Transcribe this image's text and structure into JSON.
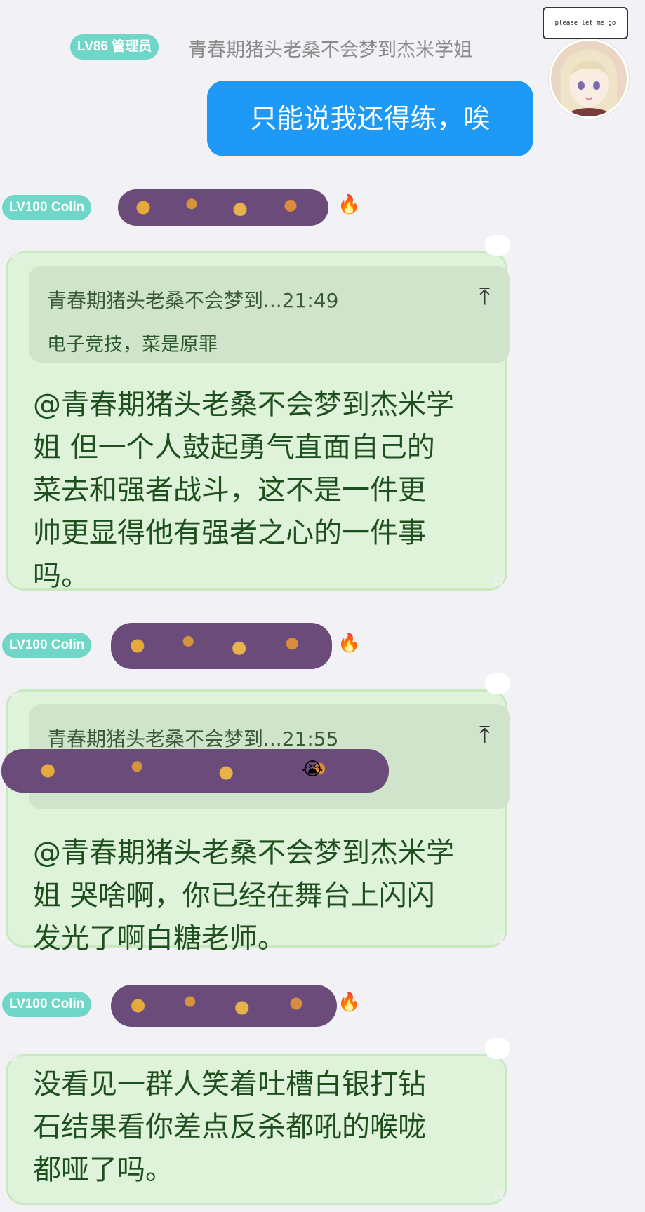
{
  "top_message": {
    "level_tag": "LV86 管理员",
    "nickname": "青春期猪头老桑不会梦到杰米学姐",
    "text": "只能说我还得练，唉",
    "avatar_caption": "please let me go"
  },
  "messages": [
    {
      "level_tag": "LV100 Colin",
      "reply_header": "青春期猪头老桑不会梦到...21:49",
      "reply_text": "电子竞技，菜是原罪",
      "lines": [
        "@青春期猪头老桑不会梦到杰米学",
        "姐 但一个人鼓起勇气直面自己的",
        "菜去和强者战斗，这不是一件更",
        "帅更显得他有强者之心的一件事",
        "吗。"
      ]
    },
    {
      "level_tag": "LV100 Colin",
      "reply_header": "青春期猪头老桑不会梦到...21:55",
      "lines": [
        "@青春期猪头老桑不会梦到杰米学",
        "姐  哭啥啊，你已经在舞台上闪闪",
        "发光了啊白糖老师。"
      ]
    },
    {
      "level_tag": "LV100 Colin",
      "lines": [
        "没看见一群人笑着吐槽白银打钻",
        "石结果看你差点反杀都吼的喉咙",
        "都哑了吗。"
      ]
    }
  ],
  "icons": {
    "reply_jump": "arrow-up-to-line",
    "badge": "fire"
  },
  "colors": {
    "own_bubble": "#1e9af6",
    "other_bubble": "#dff3da",
    "level_tag": "#6fd6c8"
  }
}
